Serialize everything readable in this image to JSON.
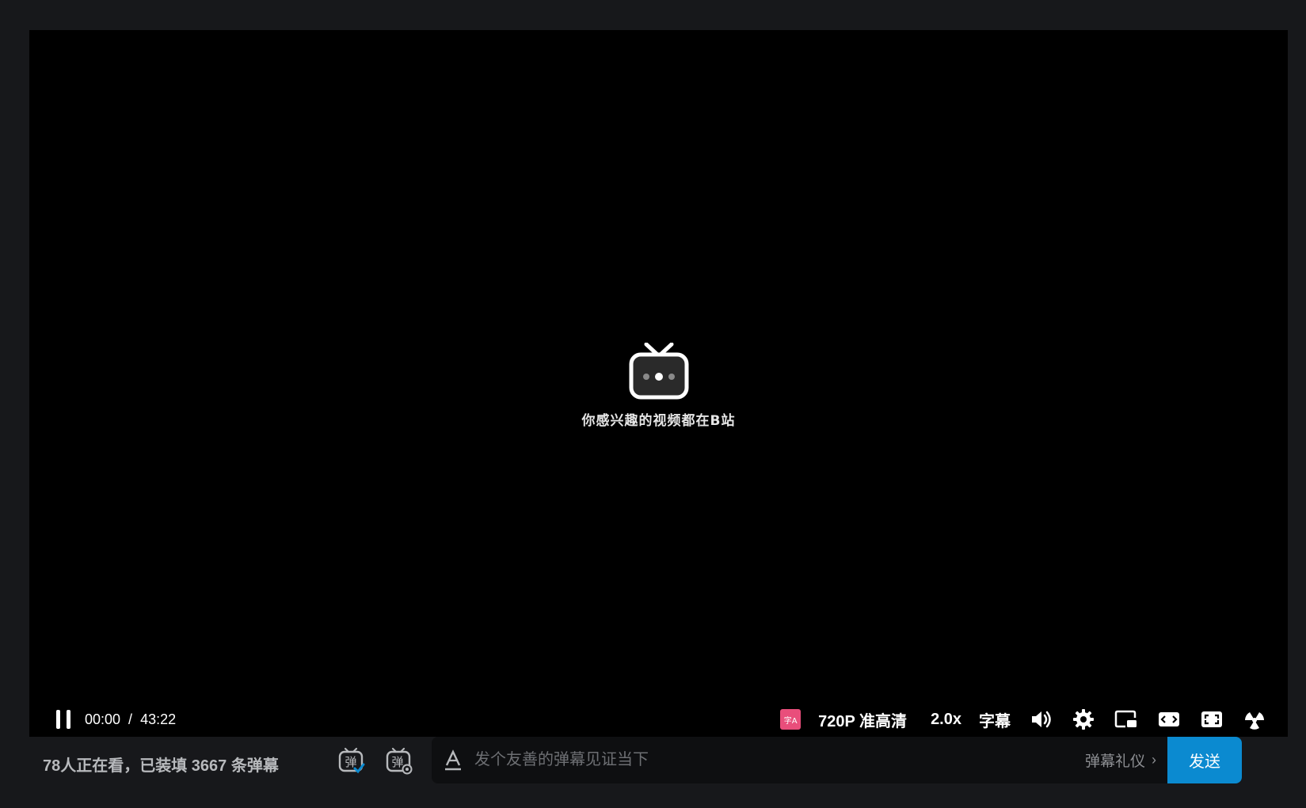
{
  "player": {
    "center_text": "你感兴趣的视频都在B站"
  },
  "controls": {
    "current_time": "00:00",
    "separator": "/",
    "duration": "43:22",
    "ai_badge_text": "字A",
    "quality": "720P 准高清",
    "speed": "2.0x",
    "subtitle": "字幕"
  },
  "bottom_bar": {
    "viewers_text": "78人正在看，已装填 3667 条弹幕",
    "input_placeholder": "发个友善的弹幕见证当下",
    "etiquette_label": "弹幕礼仪",
    "send_label": "发送"
  },
  "colors": {
    "page_bg": "#17181b",
    "player_bg": "#000000",
    "send_button": "#0b8ad0",
    "ai_badge": "#e94e7b"
  },
  "icons": {
    "pause": "pause-icon",
    "tv_logo": "bilibili-tv-icon",
    "volume": "volume-icon",
    "settings": "gear-icon",
    "pip": "picture-in-picture-icon",
    "widescreen": "widescreen-icon",
    "webfullscreen": "web-fullscreen-icon",
    "fullscreen": "fullscreen-icon",
    "danmaku_on": "danmaku-toggle-icon",
    "danmaku_settings": "danmaku-settings-icon",
    "font_style": "font-style-icon"
  }
}
